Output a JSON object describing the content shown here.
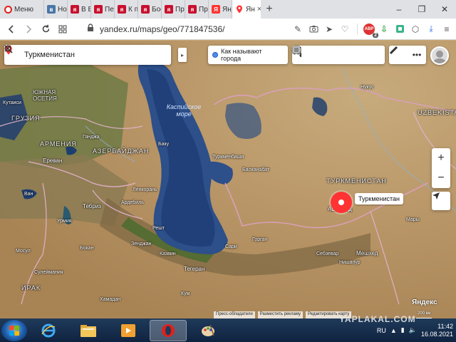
{
  "browser": {
    "tabs": [
      {
        "label": "Меню",
        "icon": "opera-icon"
      },
      {
        "label": "Нов",
        "icon": "vk-icon"
      },
      {
        "label": "В Вс",
        "icon": "yaplakal-icon"
      },
      {
        "label": "Пер",
        "icon": "yaplakal-icon"
      },
      {
        "label": "К пр",
        "icon": "yaplakal-icon"
      },
      {
        "label": "Бое",
        "icon": "yaplakal-icon"
      },
      {
        "label": "При",
        "icon": "yaplakal-icon"
      },
      {
        "label": "Про",
        "icon": "yaplakal-icon"
      },
      {
        "label": "Янд",
        "icon": "yandex-icon"
      },
      {
        "label": "Ян",
        "icon": "map-pin-icon",
        "active": true
      }
    ],
    "url": "yandex.ru/maps/geo/771847536/",
    "adblock_count": "2"
  },
  "map": {
    "search": {
      "value": "Туркменистан"
    },
    "how_called_label": "Как называют города",
    "marker_label": "Туркменистан",
    "labels": {
      "caspian": "Каспийское\nморе",
      "turkmenistan": "ТУРКМЕНИСТАН",
      "uzbekistan": "UZBEKISTA",
      "georgia": "ГРУЗИЯ",
      "armenia": "АРМЕНИЯ",
      "azerbaijan": "АЗЕРБАЙДЖАН",
      "south_ossetia": "ЮЖНАЯ\nОСЕТИЯ",
      "iraq": "ИРАК",
      "baku": "Баку",
      "ashgabat": "Ашхабад",
      "tehran": "Тегеран",
      "erevan": "Ереван",
      "tebriz": "Тебриз",
      "turkmenbashi": "Туркменбаши",
      "mary": "Мары",
      "mashhad": "Мешхед",
      "sari": "Сари",
      "rasht": "Решт",
      "kazvin": "Казвин",
      "mosul": "Мосул",
      "van": "Ван",
      "urmiya": "Урмия",
      "nukus": "Нукус",
      "gorgan": "Горган",
      "ardabil": "Ардебиль",
      "lenkoran": "Ленкорань",
      "kum": "Кум",
      "hamadan": "Хамадан",
      "ganja": "Гянджа",
      "kutaisi": "Кутаиси",
      "balkanabat": "Балканабат",
      "sulaymaniya": "Сулеймания",
      "zenjan": "Зенджан",
      "bokan": "Бокан",
      "sebzevar": "Себзевар",
      "nishapur": "Нишапур"
    },
    "footer": [
      "Пресс-обладатели",
      "Разместить рекламу",
      "Редактировать карту"
    ],
    "logo": "Яндекс",
    "scale": "200 км"
  },
  "taskbar": {
    "language": "RU",
    "time": "11:42",
    "date": "16.08.2021"
  },
  "watermark": "YAPLAKAL.COM",
  "colors": {
    "accent": "#f33",
    "water": "#2d4f8a",
    "taskbar": "#1f3a5a"
  }
}
